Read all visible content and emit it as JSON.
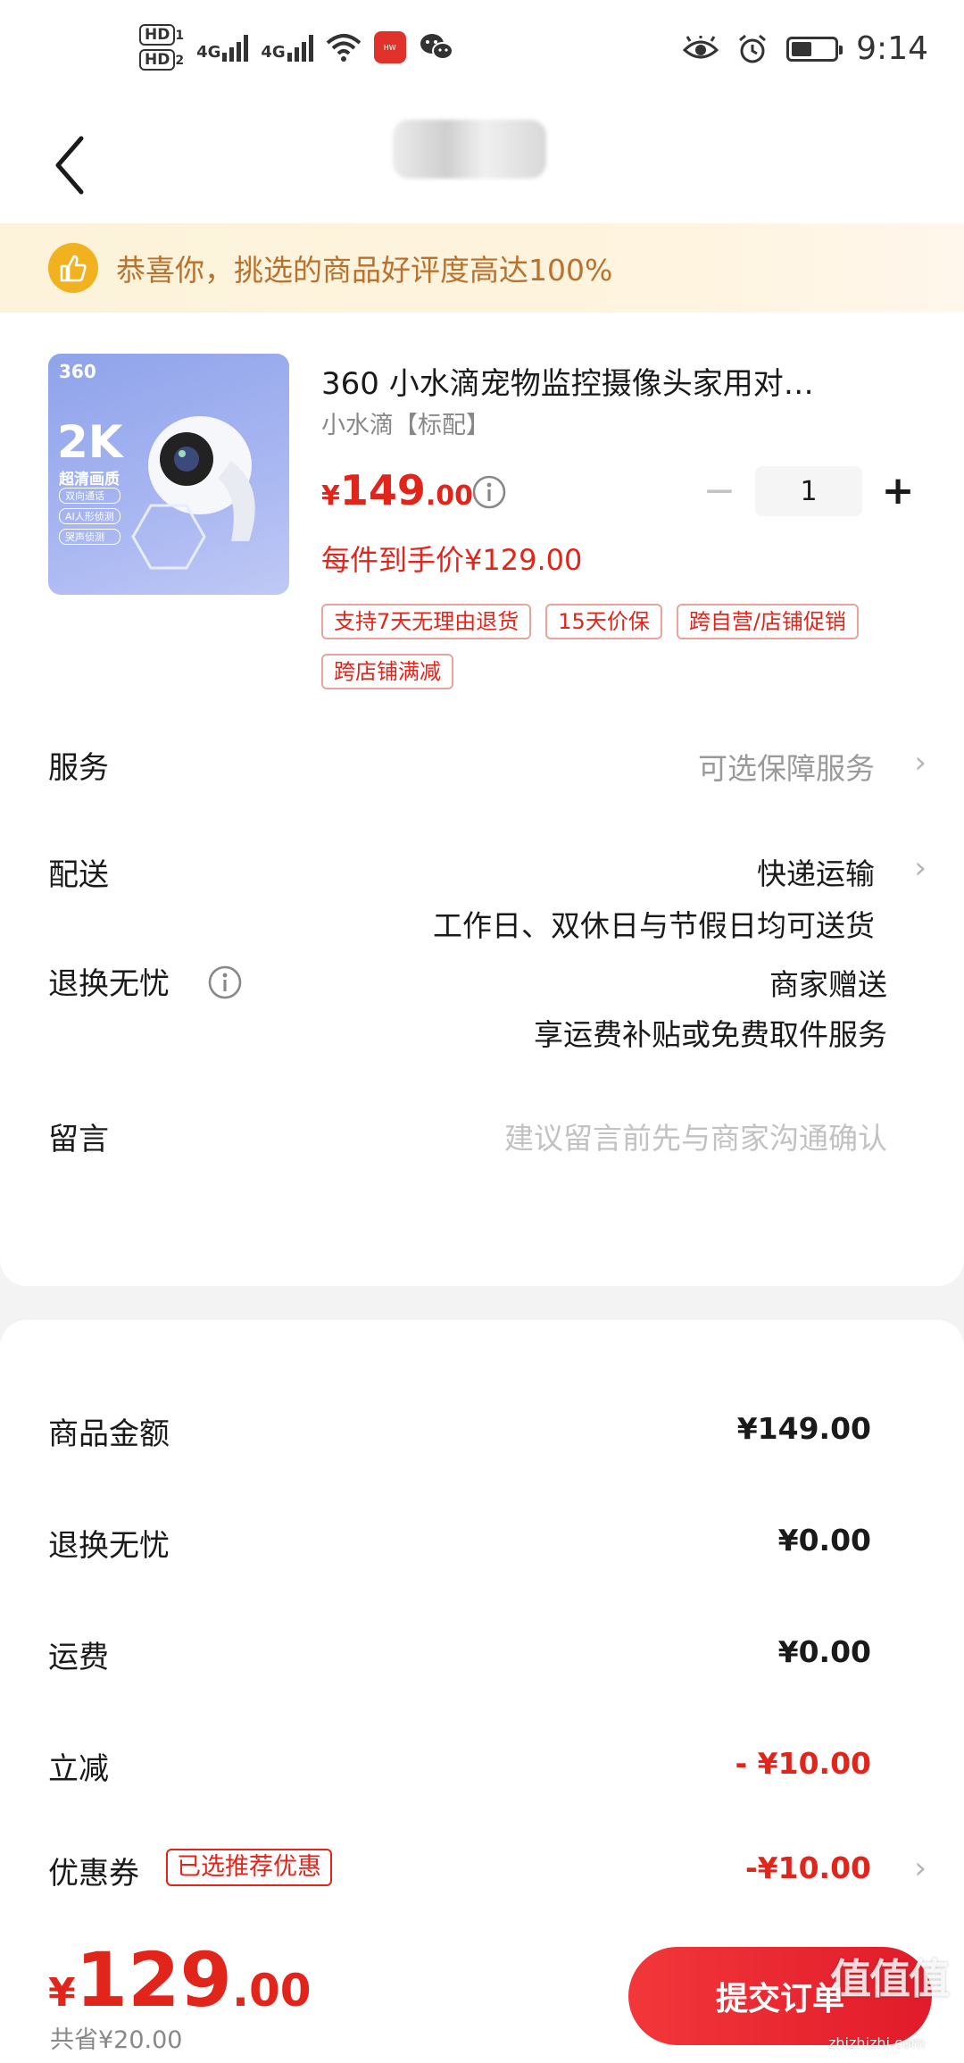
{
  "status_bar": {
    "hd1": "HD",
    "hd1_sub": "1",
    "hd2": "HD",
    "hd2_sub": "2",
    "sig1": "4G",
    "sig2": "4G",
    "time": "9:14"
  },
  "banner": {
    "text": "恭喜你，挑选的商品好评度高达100%"
  },
  "product": {
    "image_brand": "360",
    "image_headline": "2K",
    "image_subtitle": "超清画质",
    "image_features": [
      "双向通话",
      "AI人形侦测",
      "哭声侦测"
    ],
    "title": "360 小水滴宠物监控摄像头家用对…",
    "spec": "小水滴【标配】",
    "price_currency": "¥",
    "price_int": "149",
    "price_dec": ".00",
    "quantity": "1",
    "minus": "−",
    "plus": "+",
    "per_item_price": "每件到手价¥129.00",
    "tags": [
      "支持7天无理由退货",
      "15天价保",
      "跨自营/店铺促销",
      "跨店铺满减"
    ]
  },
  "rows": {
    "service_label": "服务",
    "service_value": "可选保障服务",
    "delivery_label": "配送",
    "delivery_value": "快递运输",
    "delivery_sub": "工作日、双休日与节假日均可送货",
    "return_label": "退换无忧",
    "return_value": "商家赠送",
    "return_sub": "享运费补贴或免费取件服务",
    "message_label": "留言",
    "message_placeholder": "建议留言前先与商家沟通确认"
  },
  "summary": {
    "goods_label": "商品金额",
    "goods_value": "¥149.00",
    "return_label": "退换无忧",
    "return_value": "¥0.00",
    "shipping_label": "运费",
    "shipping_value": "¥0.00",
    "discount_label": "立减",
    "discount_value": "- ¥10.00",
    "coupon_label": "优惠券",
    "coupon_tag": "已选推荐优惠",
    "coupon_value": "-¥10.00"
  },
  "bottom": {
    "total_currency": "¥",
    "total_int": "129",
    "total_dec": ".00",
    "saved": "共省¥20.00",
    "submit_label": "提交订单",
    "watermark": "值值值",
    "watermark_url": "zhizhizhi.com"
  },
  "colors": {
    "accent_red": "#e1251b",
    "banner_text": "#b8722e",
    "banner_icon": "#f2b21f"
  }
}
